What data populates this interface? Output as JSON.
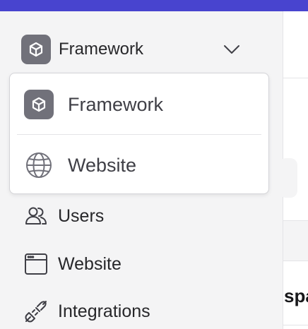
{
  "switcher": {
    "label": "Framework",
    "icon": "cube-icon",
    "chevron_icon": "chevron-down-icon"
  },
  "dropdown": {
    "items": [
      {
        "label": "Framework",
        "icon": "cube-icon"
      },
      {
        "label": "Website",
        "icon": "globe-icon"
      }
    ]
  },
  "nav": {
    "items": [
      {
        "label": "Users",
        "icon": "users-icon"
      },
      {
        "label": "Website",
        "icon": "browser-window-icon"
      },
      {
        "label": "Integrations",
        "icon": "plug-icon"
      }
    ]
  },
  "main": {
    "partial_text": "spa"
  },
  "colors": {
    "topbar": "#4844cf",
    "sidebar_bg": "#f4f4f5",
    "badge_bg": "#71717a"
  }
}
